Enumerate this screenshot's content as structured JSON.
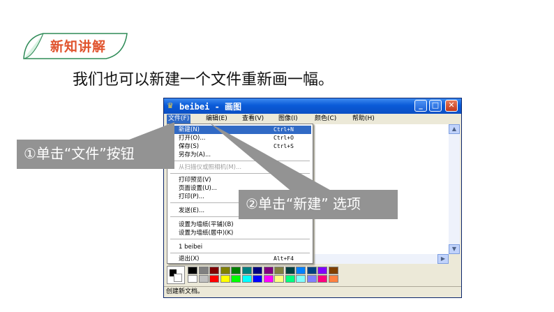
{
  "section_tag": "新知讲解",
  "intro_text": "我们也可以新建一个文件重新画一幅。",
  "window": {
    "title": "beibei - 画图",
    "menus": [
      "文件(F)",
      "编辑(E)",
      "查看(V)",
      "图像(I)",
      "颜色(C)",
      "帮助(H)"
    ],
    "status_text": "创建新文档。"
  },
  "file_menu": {
    "items": [
      {
        "label": "新建(N)",
        "shortcut": "Ctrl+N"
      },
      {
        "label": "打开(O)...",
        "shortcut": "Ctrl+O"
      },
      {
        "label": "保存(S)",
        "shortcut": "Ctrl+S"
      },
      {
        "label": "另存为(A)...",
        "shortcut": ""
      },
      {
        "label": "从扫描仪或照相机(M)...",
        "shortcut": ""
      },
      {
        "label": "打印预览(V)",
        "shortcut": ""
      },
      {
        "label": "页面设置(U)...",
        "shortcut": ""
      },
      {
        "label": "打印(P)...",
        "shortcut": ""
      },
      {
        "label": "发送(E)...",
        "shortcut": ""
      },
      {
        "label": "设置为墙纸(平铺)(B)",
        "shortcut": ""
      },
      {
        "label": "设置为墙纸(居中)(K)",
        "shortcut": ""
      },
      {
        "label": "1 beibei",
        "shortcut": ""
      },
      {
        "label": "退出(X)",
        "shortcut": "Alt+F4"
      }
    ]
  },
  "palette_colors": [
    "#000000",
    "#808080",
    "#800000",
    "#808000",
    "#008000",
    "#008080",
    "#000080",
    "#800080",
    "#808040",
    "#004040",
    "#0080ff",
    "#004080",
    "#8000ff",
    "#804000",
    "#ffffff",
    "#c0c0c0",
    "#ff0000",
    "#ffff00",
    "#00ff00",
    "#00ffff",
    "#0000ff",
    "#ff00ff",
    "#ffff80",
    "#00ff80",
    "#80ffff",
    "#8080ff",
    "#ff0080",
    "#ff8040"
  ],
  "callouts": {
    "step1": "①单击“文件”按钮",
    "step2": "②单击“新建” 选项"
  },
  "colors": {
    "tag_text": "#e0532d",
    "tag_border": "#2e8b57",
    "callout_bg": "#939393",
    "highlight": "#316ac5"
  }
}
